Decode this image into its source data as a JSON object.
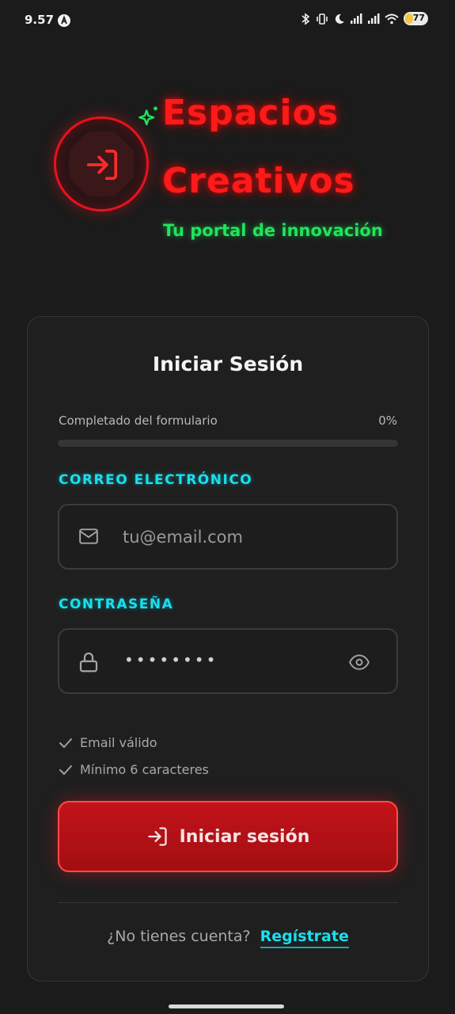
{
  "status_bar": {
    "time": "9.57",
    "battery": "77",
    "icons": [
      "nav-a-icon",
      "bluetooth-icon",
      "vibrate-icon",
      "moon-icon",
      "signal-icon",
      "signal-icon",
      "wifi-icon",
      "battery-icon"
    ]
  },
  "hero": {
    "brand_line1": "Espacios",
    "brand_line2": "Creativos",
    "tagline": "Tu portal de innovación",
    "logo_icon": "login-arrow-icon",
    "sparkle_icon": "sparkles-icon"
  },
  "form": {
    "title": "Iniciar Sesión",
    "progress_label": "Completado del formulario",
    "progress_percent_text": "0%",
    "progress_fraction": 0,
    "email": {
      "label": "CORREO ELECTRÓNICO",
      "placeholder": "tu@email.com",
      "value": "",
      "icon": "mail-icon"
    },
    "password": {
      "label": "CONTRASEÑA",
      "masked_value": "••••••••",
      "icon": "lock-icon",
      "toggle_icon": "eye-icon"
    },
    "checks": [
      {
        "text": "Email válido",
        "icon": "check-icon"
      },
      {
        "text": "Mínimo 6 caracteres",
        "icon": "check-icon"
      }
    ],
    "submit_label": "Iniciar sesión",
    "submit_icon": "login-arrow-icon",
    "footer_text": "¿No tienes cuenta?",
    "register_link": "Regístrate"
  },
  "colors": {
    "background": "#1b1b1b",
    "brand_red": "#ff1a1a",
    "tagline_green": "#21e45a",
    "accent_cyan": "#17e0ef",
    "button_red": "#b11016"
  }
}
